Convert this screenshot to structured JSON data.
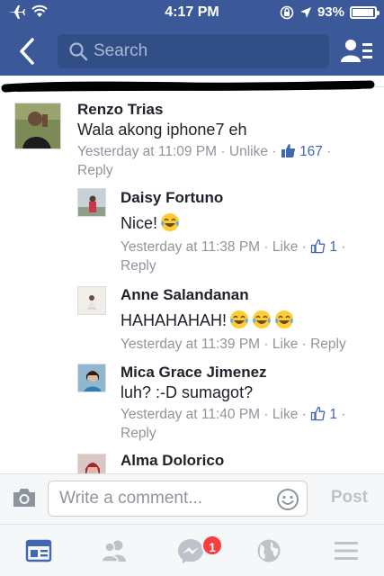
{
  "status_bar": {
    "time": "4:17 PM",
    "battery": "93%",
    "battery_level": 0.93
  },
  "nav": {
    "search_placeholder": "Search"
  },
  "comments": [
    {
      "name": "Renzo Trias",
      "text": "Wala akong iphone7 eh",
      "time": "Yesterday at 11:09 PM",
      "action": "Unlike",
      "likes": "167",
      "reply": "Reply"
    },
    {
      "name": "Daisy Fortuno",
      "text": "Nice!",
      "time": "Yesterday at 11:38 PM",
      "action": "Like",
      "likes": "1",
      "reply": "Reply"
    },
    {
      "name": "Anne Salandanan",
      "text": "HAHAHAHAH!",
      "time": "Yesterday at 11:39 PM",
      "action": "Like",
      "reply": "Reply"
    },
    {
      "name": "Mica Grace Jimenez",
      "text": "luh? :-D sumagot?",
      "time": "Yesterday at 11:40 PM",
      "action": "Like",
      "likes": "1",
      "reply": "Reply"
    },
    {
      "name": "Alma Dolorico"
    }
  ],
  "composer": {
    "placeholder": "Write a comment...",
    "post_label": "Post"
  },
  "tabbar": {
    "items": [
      "news-feed-icon",
      "friends-icon",
      "messenger-icon",
      "globe-icon",
      "menu-icon"
    ],
    "messenger_badge": "1"
  },
  "colors": {
    "brand": "#3b5998",
    "link": "#4267b2",
    "meta": "#90949c",
    "badge": "#fa3e3e"
  }
}
